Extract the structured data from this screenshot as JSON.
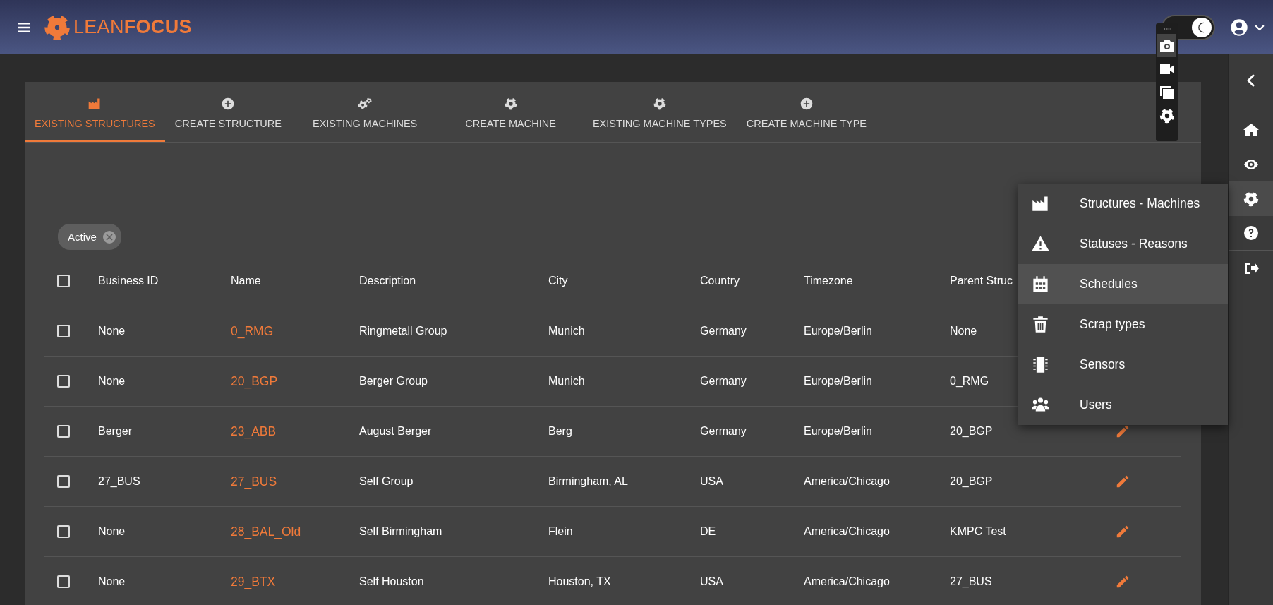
{
  "header": {
    "logo": "LEAN**FOCUS**",
    "dark_mode": true
  },
  "capture_toolbar": {
    "items": [
      {
        "kind": "camera",
        "selected": true
      },
      {
        "kind": "video",
        "selected": false
      },
      {
        "kind": "windows",
        "selected": false
      },
      {
        "kind": "settings",
        "selected": false
      }
    ]
  },
  "tabs": [
    {
      "label": "EXISTING STRUCTURES",
      "kind": "factory",
      "selected": true
    },
    {
      "label": "CREATE STRUCTURE",
      "kind": "plus",
      "selected": false
    },
    {
      "label": "EXISTING MACHINES",
      "kind": "gears",
      "selected": false
    },
    {
      "label": "CREATE MACHINE",
      "kind": "gear",
      "selected": false
    },
    {
      "label": "EXISTING MACHINE TYPES",
      "kind": "gear",
      "selected": false
    },
    {
      "label": "CREATE MACHINE TYPE",
      "kind": "plus",
      "selected": false
    }
  ],
  "filters": [
    {
      "label": "Active"
    }
  ],
  "table": {
    "header_checked": false,
    "columns": [
      "Business ID",
      "Name",
      "Description",
      "City",
      "Country",
      "Timezone",
      "Parent Struc"
    ],
    "rows": [
      {
        "checked": false,
        "edit_icon": false,
        "cells": [
          "None",
          "0_RMG",
          "Ringmetall Group",
          "Munich",
          "Germany",
          "Europe/Berlin",
          "None"
        ]
      },
      {
        "checked": false,
        "edit_icon": false,
        "cells": [
          "None",
          "20_BGP",
          "Berger Group",
          "Munich",
          "Germany",
          "Europe/Berlin",
          "0_RMG"
        ]
      },
      {
        "checked": false,
        "edit_icon": true,
        "cells": [
          "Berger",
          "23_ABB",
          "August Berger",
          "Berg",
          "Germany",
          "Europe/Berlin",
          "20_BGP"
        ]
      },
      {
        "checked": false,
        "edit_icon": true,
        "cells": [
          "27_BUS",
          "27_BUS",
          "Self Group",
          "Birmingham, AL",
          "USA",
          "America/Chicago",
          "20_BGP"
        ]
      },
      {
        "checked": false,
        "edit_icon": true,
        "cells": [
          "None",
          "28_BAL_Old",
          "Self Birmingham",
          "Flein",
          "DE",
          "America/Chicago",
          "KMPC Test"
        ]
      },
      {
        "checked": false,
        "edit_icon": true,
        "cells": [
          "None",
          "29_BTX",
          "Self Houston",
          "Houston, TX",
          "USA",
          "America/Chicago",
          "27_BUS"
        ]
      }
    ]
  },
  "settings_menu": {
    "items": [
      {
        "label": "Structures - Machines",
        "kind": "factory",
        "selected": false
      },
      {
        "label": "Statuses - Reasons",
        "kind": "warning",
        "selected": false
      },
      {
        "label": "Schedules",
        "kind": "calendar",
        "selected": true
      },
      {
        "label": "Scrap types",
        "kind": "trash",
        "selected": false
      },
      {
        "label": "Sensors",
        "kind": "chip",
        "selected": false
      },
      {
        "label": "Users",
        "kind": "users",
        "selected": false
      }
    ]
  },
  "sidebar": {
    "items": [
      {
        "kind": "collapse",
        "selected": false
      },
      {
        "kind": "home",
        "selected": false
      },
      {
        "kind": "view",
        "selected": false
      },
      {
        "kind": "settings",
        "selected": true
      },
      {
        "kind": "help",
        "selected": false
      },
      {
        "kind": "logout",
        "selected": false
      }
    ]
  }
}
